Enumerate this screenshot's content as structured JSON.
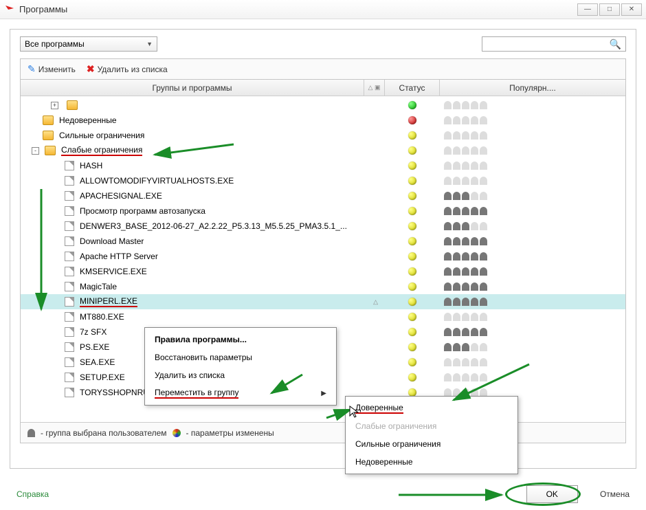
{
  "window": {
    "title": "Программы",
    "minimize": "—",
    "maximize": "□",
    "close": "✕"
  },
  "toprow": {
    "filter": "Все программы",
    "search_placeholder": ""
  },
  "toolbar": {
    "edit": "Изменить",
    "delete": "Удалить из списка"
  },
  "columns": {
    "name": "Группы и программы",
    "sort": "△ ▣",
    "status": "Статус",
    "popularity": "Популярн...."
  },
  "tree": [
    {
      "type": "file",
      "indent": 36,
      "label": "",
      "status": "green",
      "pop": 0,
      "prefix_expander": "+",
      "prefix_folder": true
    },
    {
      "type": "folder",
      "indent": 24,
      "label": "Недоверенные",
      "status": "red",
      "pop": 0
    },
    {
      "type": "folder",
      "indent": 24,
      "label": "Сильные ограничения",
      "status": "yellow",
      "pop": 0
    },
    {
      "type": "folder",
      "indent": 24,
      "label": "Слабые ограничения",
      "status": "yellow",
      "pop": 0,
      "expander": "-",
      "underline": true
    },
    {
      "type": "file",
      "indent": 56,
      "label": "HASH",
      "status": "yellow",
      "pop": 0
    },
    {
      "type": "file",
      "indent": 56,
      "label": "ALLOWTOMODIFYVIRTUALHOSTS.EXE",
      "status": "yellow",
      "pop": 0
    },
    {
      "type": "file",
      "indent": 56,
      "label": "APACHESIGNAL.EXE",
      "status": "yellow",
      "pop": 3
    },
    {
      "type": "file",
      "indent": 56,
      "label": "Просмотр программ автозапуска",
      "status": "yellow",
      "pop": 5
    },
    {
      "type": "file",
      "indent": 56,
      "label": "DENWER3_BASE_2012-06-27_A2.2.22_P5.3.13_M5.5.25_PMA3.5.1_...",
      "status": "yellow",
      "pop": 3
    },
    {
      "type": "file",
      "indent": 56,
      "label": "Download Master",
      "status": "yellow",
      "pop": 5
    },
    {
      "type": "file",
      "indent": 56,
      "label": "Apache HTTP Server",
      "status": "yellow",
      "pop": 5
    },
    {
      "type": "file",
      "indent": 56,
      "label": "KMSERVICE.EXE",
      "status": "yellow",
      "pop": 5
    },
    {
      "type": "file",
      "indent": 56,
      "label": "MagicTale",
      "status": "yellow",
      "pop": 5
    },
    {
      "type": "file",
      "indent": 56,
      "label": "MINIPERL.EXE",
      "status": "yellow",
      "pop": 5,
      "selected": true,
      "underline": true,
      "extra": "△"
    },
    {
      "type": "file",
      "indent": 56,
      "label": "MT880.EXE",
      "status": "yellow",
      "pop": 0
    },
    {
      "type": "file",
      "indent": 56,
      "label": "7z SFX",
      "status": "yellow",
      "pop": 5
    },
    {
      "type": "file",
      "indent": 56,
      "label": "PS.EXE",
      "status": "yellow",
      "pop": 3
    },
    {
      "type": "file",
      "indent": 56,
      "label": "SEA.EXE",
      "status": "yellow",
      "pop": 0
    },
    {
      "type": "file",
      "indent": 56,
      "label": "SETUP.EXE",
      "status": "yellow",
      "pop": 0
    },
    {
      "type": "file",
      "indent": 56,
      "label": "TORYSSHOPNRUSH.EXE",
      "status": "yellow",
      "pop": 0
    }
  ],
  "context_menu": [
    {
      "label": "Правила программы...",
      "bold": true
    },
    {
      "label": "Восстановить параметры"
    },
    {
      "label": "Удалить из списка"
    },
    {
      "label": "Переместить в группу",
      "submenu": true,
      "underline": true
    }
  ],
  "submenu": [
    {
      "label": "Доверенные",
      "underline": true
    },
    {
      "label": "Слабые ограничения",
      "disabled": true
    },
    {
      "label": "Сильные ограничения"
    },
    {
      "label": "Недоверенные"
    }
  ],
  "legend": {
    "user_group": "- группа выбрана пользователем",
    "params_changed": "- параметры изменены"
  },
  "footer": {
    "help": "Справка",
    "ok": "OK",
    "cancel": "Отмена"
  }
}
